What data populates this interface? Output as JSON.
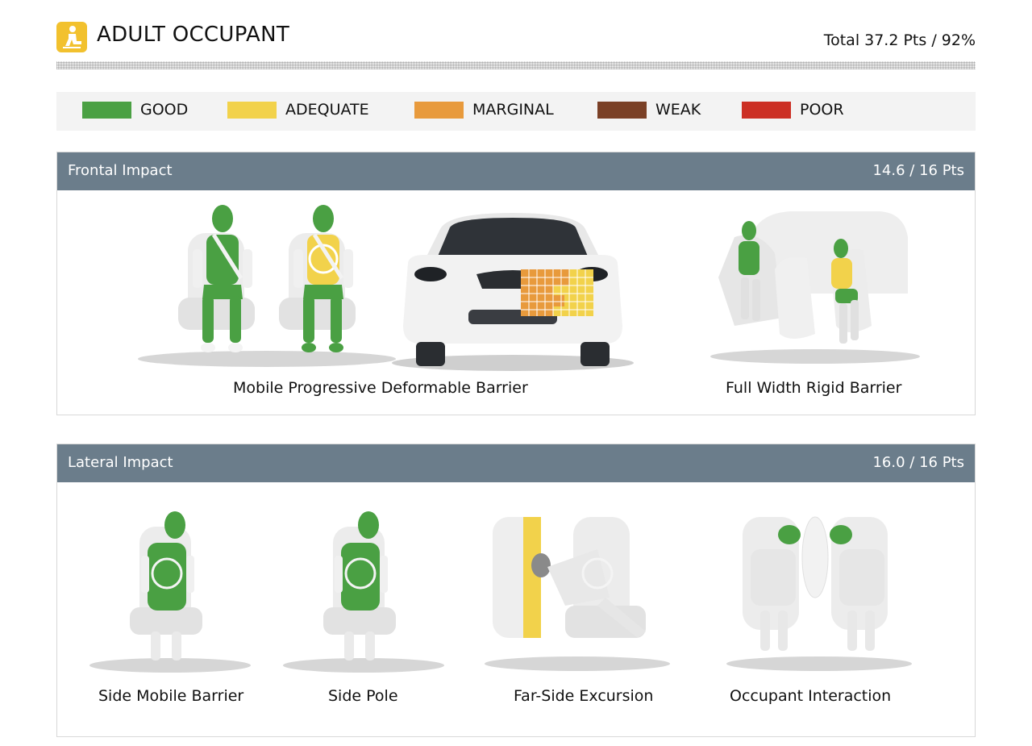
{
  "header": {
    "title": "ADULT OCCUPANT",
    "total": "Total 37.2 Pts / 92%",
    "icon": "seated-occupant-icon"
  },
  "legend": [
    {
      "label": "GOOD",
      "color": "#4aa043"
    },
    {
      "label": "ADEQUATE",
      "color": "#f2d24b"
    },
    {
      "label": "MARGINAL",
      "color": "#e89a3c"
    },
    {
      "label": "WEAK",
      "color": "#7a4026"
    },
    {
      "label": "POOR",
      "color": "#cc2f24"
    }
  ],
  "frontal": {
    "title": "Frontal Impact",
    "score": "14.6 / 16 Pts",
    "tests": [
      {
        "caption": "Mobile Progressive Deformable Barrier"
      },
      {
        "caption": "Full Width Rigid Barrier"
      }
    ]
  },
  "lateral": {
    "title": "Lateral Impact",
    "score": "16.0 / 16 Pts",
    "tests": [
      {
        "caption": "Side Mobile Barrier"
      },
      {
        "caption": "Side Pole"
      },
      {
        "caption": "Far-Side Excursion"
      },
      {
        "caption": "Occupant Interaction"
      }
    ]
  },
  "colors": {
    "panel_bar": "#6b7d8b",
    "good": "#4aa043",
    "adequate": "#f2d24b",
    "marginal": "#e89a3c"
  }
}
